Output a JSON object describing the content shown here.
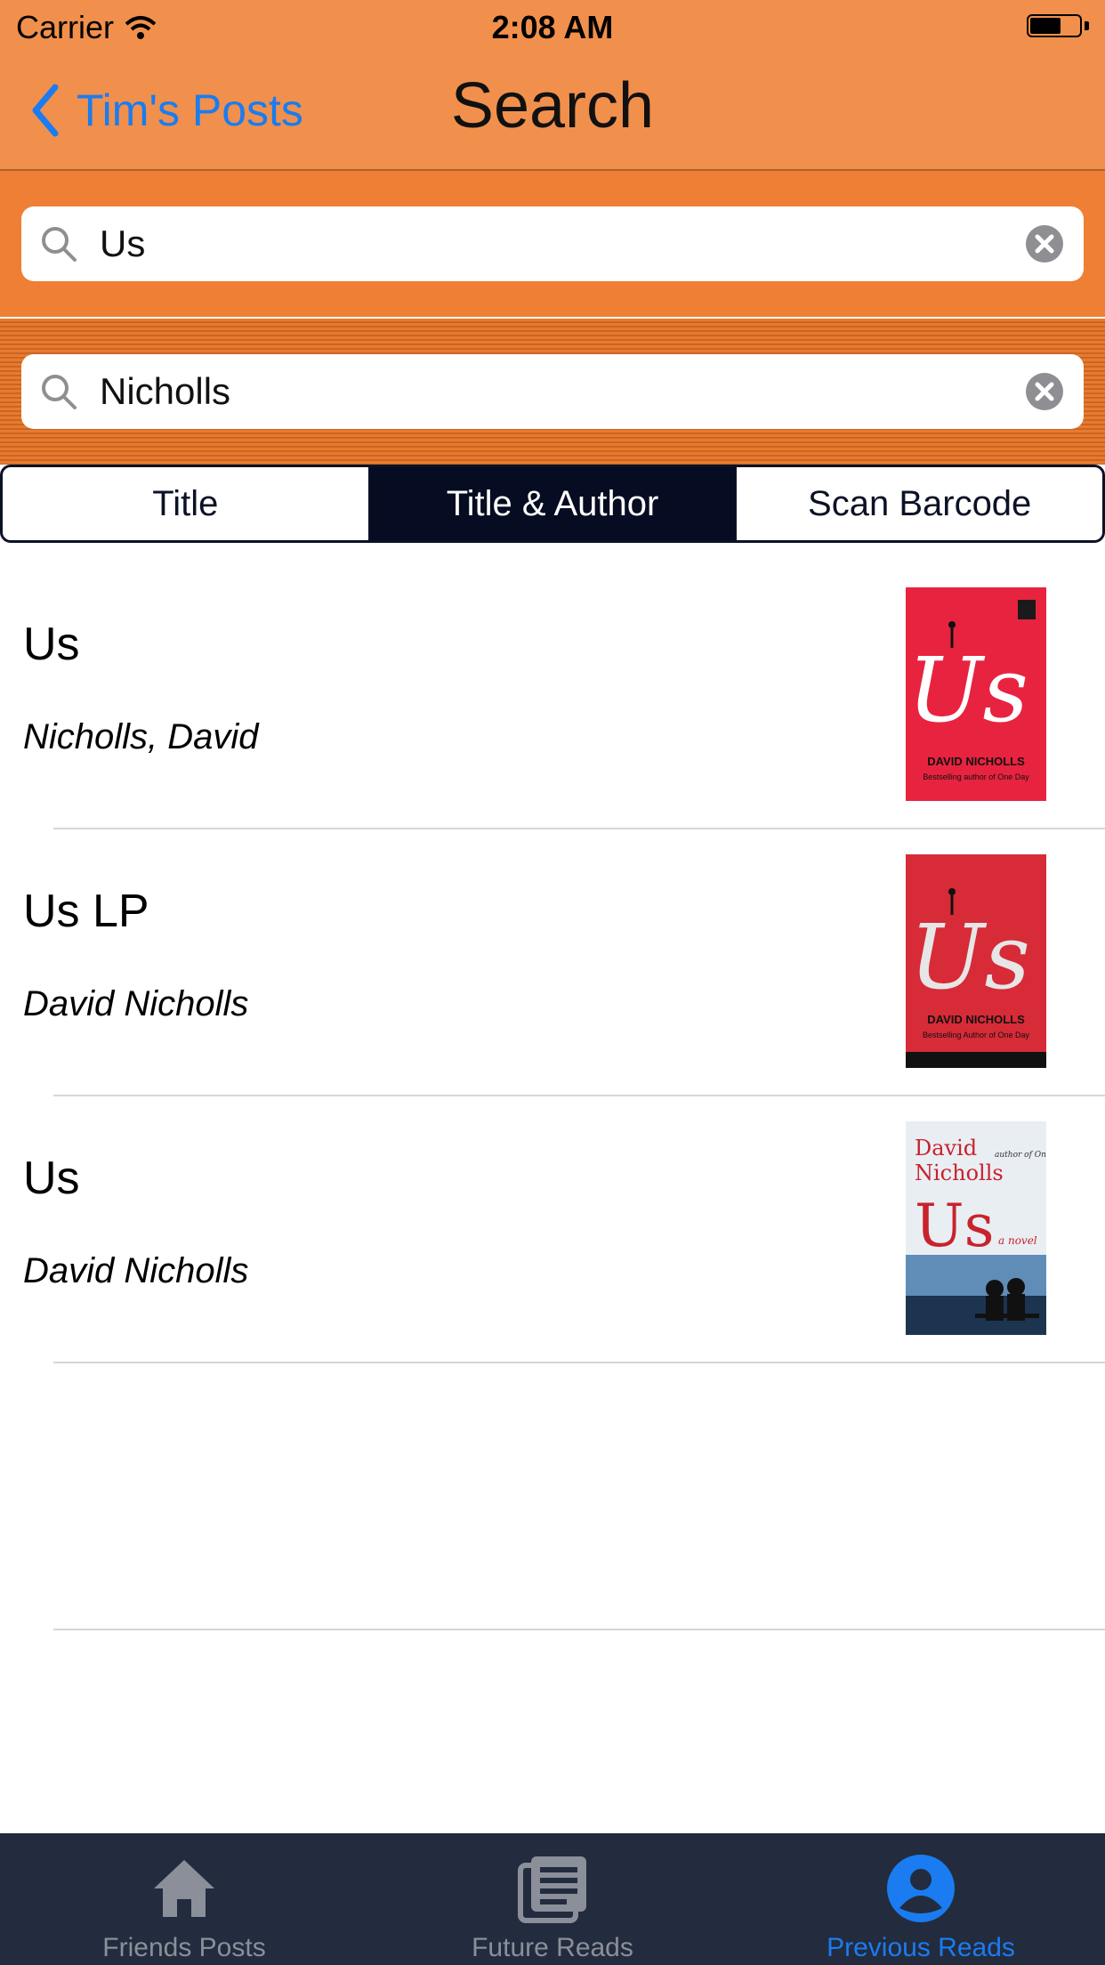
{
  "status_bar": {
    "carrier": "Carrier",
    "time": "2:08 AM"
  },
  "nav": {
    "back_label": "Tim's Posts",
    "title": "Search"
  },
  "search": {
    "title_query": "Us",
    "author_query": "Nicholls"
  },
  "segments": [
    {
      "label": "Title",
      "selected": false
    },
    {
      "label": "Title & Author",
      "selected": true
    },
    {
      "label": "Scan Barcode",
      "selected": false
    }
  ],
  "results": [
    {
      "title": "Us",
      "author": "Nicholls, David",
      "cover": {
        "author": "DAVID NICHOLLS",
        "word": "Us",
        "tagline": "Bestselling author of One Day",
        "bg": "#e8233f"
      }
    },
    {
      "title": "Us LP",
      "author": "David Nicholls",
      "cover": {
        "author": "DAVID NICHOLLS",
        "word": "Us",
        "tagline": "Bestselling Author of One Day",
        "bg": "#d72b37"
      }
    },
    {
      "title": "Us",
      "author": "David Nicholls",
      "cover": {
        "author_line1": "David",
        "author_line2": "Nicholls",
        "word": "Us",
        "subtitle": "a novel",
        "tagline": "author of One Day",
        "bg": "#e9eef3"
      }
    }
  ],
  "tabs": [
    {
      "label": "Friends Posts",
      "icon": "home-icon",
      "active": false
    },
    {
      "label": "Future Reads",
      "icon": "news-icon",
      "active": false
    },
    {
      "label": "Previous Reads",
      "icon": "person-icon",
      "active": true
    }
  ],
  "colors": {
    "nav_bg": "#f1904c",
    "search_bg": "#ee7f34",
    "accent": "#1a7cf0",
    "segment_active": "#060c21",
    "tabbar_bg": "#232b3e"
  }
}
